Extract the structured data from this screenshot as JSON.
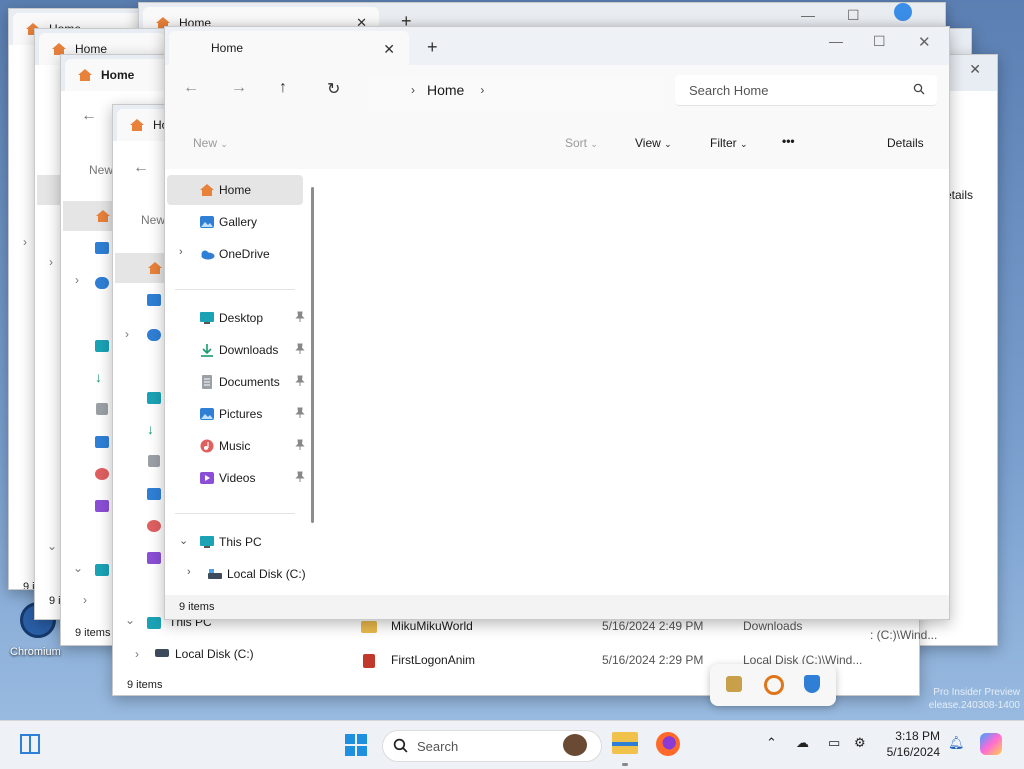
{
  "desktop": {
    "icon_label": "Chromium",
    "watermark_line1": "Pro Insider Preview",
    "watermark_line2": "elease.240308-1400"
  },
  "background_windows": {
    "tab_title": "Home",
    "new_label": "New",
    "details_label": "etails",
    "status": "9 items",
    "this_pc": "This PC",
    "local_disk": "Local Disk (C:)",
    "partial_status": "9 i",
    "files": [
      {
        "name": "MikuMikuWorld",
        "date": "5/16/2024 2:49 PM",
        "location": "Downloads"
      },
      {
        "name": "FirstLogonAnim",
        "date": "5/16/2024 2:29 PM",
        "location": "Local Disk (C:)\\Wind..."
      }
    ],
    "partial_path": ": (C:)\\Wind..."
  },
  "main_window": {
    "tab_title": "Home",
    "address": {
      "crumb": "Home"
    },
    "search_placeholder": "Search Home",
    "commands": {
      "new": "New",
      "sort": "Sort",
      "view": "View",
      "filter": "Filter",
      "more": "•••",
      "details": "Details"
    },
    "sidebar": {
      "top": [
        {
          "label": "Home",
          "icon": "home-icon"
        },
        {
          "label": "Gallery",
          "icon": "gallery-icon"
        },
        {
          "label": "OneDrive",
          "icon": "onedrive-icon"
        }
      ],
      "quick": [
        {
          "label": "Desktop",
          "icon": "desktop-icon"
        },
        {
          "label": "Downloads",
          "icon": "downloads-icon"
        },
        {
          "label": "Documents",
          "icon": "documents-icon"
        },
        {
          "label": "Pictures",
          "icon": "pictures-icon"
        },
        {
          "label": "Music",
          "icon": "music-icon"
        },
        {
          "label": "Videos",
          "icon": "videos-icon"
        }
      ],
      "this_pc": "This PC",
      "local_disk": "Local Disk (C:)"
    },
    "status": "9 items"
  },
  "taskbar": {
    "search_placeholder": "Search",
    "time": "3:18 PM",
    "date": "5/16/2024"
  },
  "colors": {
    "home": "#e8823a",
    "blue": "#2f7fd6",
    "teal": "#1aa3b5",
    "music": "#e06060",
    "videos": "#8a4fd6"
  }
}
